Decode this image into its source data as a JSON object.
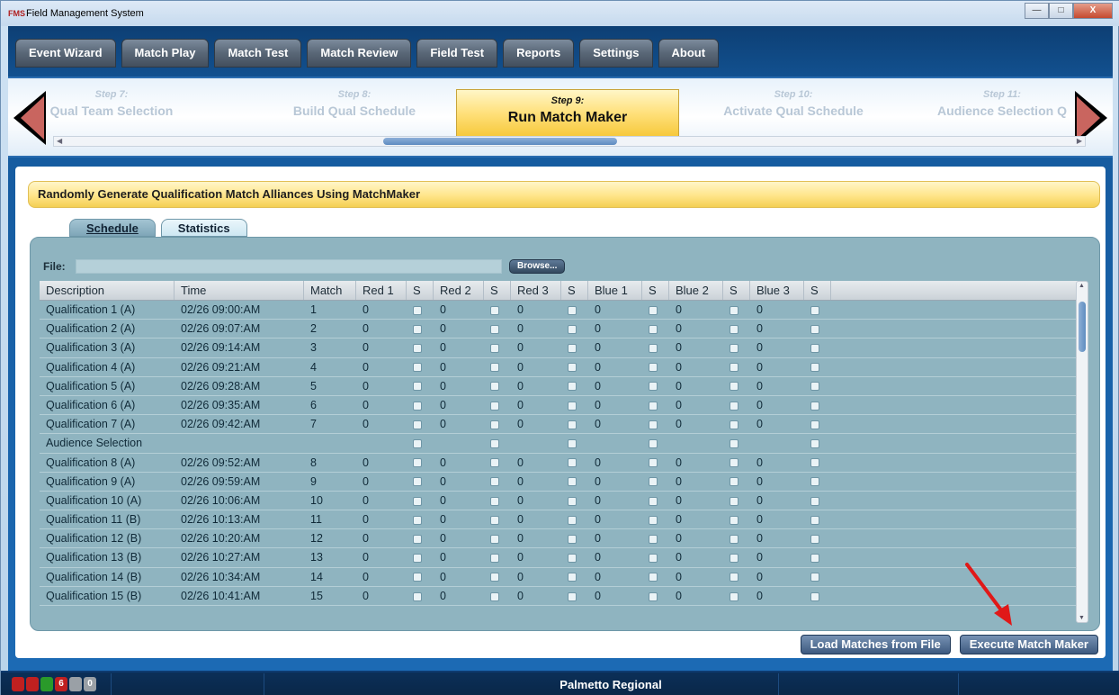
{
  "window": {
    "title": "Field Management System",
    "title_icon": "FMS"
  },
  "window_controls": {
    "minimize": "—",
    "maximize": "□",
    "close": "X"
  },
  "menu": [
    {
      "label": "Event Wizard"
    },
    {
      "label": "Match Play"
    },
    {
      "label": "Match Test"
    },
    {
      "label": "Match Review"
    },
    {
      "label": "Field Test"
    },
    {
      "label": "Reports"
    },
    {
      "label": "Settings"
    },
    {
      "label": "About"
    }
  ],
  "wizard": {
    "steps": [
      {
        "num": "Step 7:",
        "name": "Qual Team Selection"
      },
      {
        "num": "Step 8:",
        "name": "Build Qual Schedule"
      },
      {
        "num": "Step 9:",
        "name": "Run Match Maker"
      },
      {
        "num": "Step 10:",
        "name": "Activate Qual Schedule"
      },
      {
        "num": "Step 11:",
        "name": "Audience Selection Q"
      }
    ],
    "active_index": 2
  },
  "banner": "Randomly Generate Qualification Match Alliances Using MatchMaker",
  "subtabs": [
    {
      "label": "Schedule",
      "active": false
    },
    {
      "label": "Statistics",
      "active": true
    }
  ],
  "file": {
    "label": "File:",
    "value": "",
    "browse_label": "Browse..."
  },
  "table": {
    "columns": [
      "Description",
      "Time",
      "Match",
      "Red 1",
      "S",
      "Red 2",
      "S",
      "Red 3",
      "S",
      "Blue 1",
      "S",
      "Blue 2",
      "S",
      "Blue 3",
      "S"
    ],
    "rows": [
      {
        "desc": "Qualification 1 (A)",
        "time": "02/26 09:00:AM",
        "match": "1",
        "teams": [
          "0",
          "0",
          "0",
          "0",
          "0",
          "0"
        ]
      },
      {
        "desc": "Qualification 2 (A)",
        "time": "02/26 09:07:AM",
        "match": "2",
        "teams": [
          "0",
          "0",
          "0",
          "0",
          "0",
          "0"
        ]
      },
      {
        "desc": "Qualification 3 (A)",
        "time": "02/26 09:14:AM",
        "match": "3",
        "teams": [
          "0",
          "0",
          "0",
          "0",
          "0",
          "0"
        ]
      },
      {
        "desc": "Qualification 4 (A)",
        "time": "02/26 09:21:AM",
        "match": "4",
        "teams": [
          "0",
          "0",
          "0",
          "0",
          "0",
          "0"
        ]
      },
      {
        "desc": "Qualification 5 (A)",
        "time": "02/26 09:28:AM",
        "match": "5",
        "teams": [
          "0",
          "0",
          "0",
          "0",
          "0",
          "0"
        ]
      },
      {
        "desc": "Qualification 6 (A)",
        "time": "02/26 09:35:AM",
        "match": "6",
        "teams": [
          "0",
          "0",
          "0",
          "0",
          "0",
          "0"
        ]
      },
      {
        "desc": "Qualification 7 (A)",
        "time": "02/26 09:42:AM",
        "match": "7",
        "teams": [
          "0",
          "0",
          "0",
          "0",
          "0",
          "0"
        ]
      },
      {
        "desc": "Audience Selection",
        "time": "",
        "match": "",
        "teams": [
          "",
          "",
          "",
          "",
          "",
          ""
        ]
      },
      {
        "desc": "Qualification 8 (A)",
        "time": "02/26 09:52:AM",
        "match": "8",
        "teams": [
          "0",
          "0",
          "0",
          "0",
          "0",
          "0"
        ]
      },
      {
        "desc": "Qualification 9 (A)",
        "time": "02/26 09:59:AM",
        "match": "9",
        "teams": [
          "0",
          "0",
          "0",
          "0",
          "0",
          "0"
        ]
      },
      {
        "desc": "Qualification 10 (A)",
        "time": "02/26 10:06:AM",
        "match": "10",
        "teams": [
          "0",
          "0",
          "0",
          "0",
          "0",
          "0"
        ]
      },
      {
        "desc": "Qualification 11 (B)",
        "time": "02/26 10:13:AM",
        "match": "11",
        "teams": [
          "0",
          "0",
          "0",
          "0",
          "0",
          "0"
        ]
      },
      {
        "desc": "Qualification 12 (B)",
        "time": "02/26 10:20:AM",
        "match": "12",
        "teams": [
          "0",
          "0",
          "0",
          "0",
          "0",
          "0"
        ]
      },
      {
        "desc": "Qualification 13 (B)",
        "time": "02/26 10:27:AM",
        "match": "13",
        "teams": [
          "0",
          "0",
          "0",
          "0",
          "0",
          "0"
        ]
      },
      {
        "desc": "Qualification 14 (B)",
        "time": "02/26 10:34:AM",
        "match": "14",
        "teams": [
          "0",
          "0",
          "0",
          "0",
          "0",
          "0"
        ]
      },
      {
        "desc": "Qualification 15 (B)",
        "time": "02/26 10:41:AM",
        "match": "15",
        "teams": [
          "0",
          "0",
          "0",
          "0",
          "0",
          "0"
        ]
      }
    ]
  },
  "buttons": {
    "load": "Load Matches from File",
    "execute": "Execute Match Maker"
  },
  "status": {
    "event_name": "Palmetto Regional",
    "indicators": [
      "",
      "",
      "",
      "6",
      "",
      "0"
    ],
    "indicator_colors": [
      "#c02020",
      "#c02020",
      "#2a9a2a",
      "#c02020",
      "#9aa0a6",
      "#9aa0a6"
    ]
  },
  "colors": {
    "accent_blue": "#1c6ab4",
    "banner_yellow": "#ffe58a",
    "grid_teal": "#8fb4c0",
    "red_arrow": "#e01818"
  }
}
